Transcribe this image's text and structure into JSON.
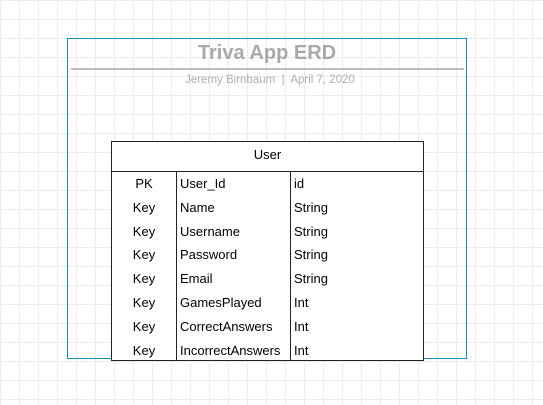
{
  "diagram": {
    "title": "Triva App ERD",
    "subtitle": "Jeremy Birnbaum  |  April 7, 2020"
  },
  "entity": {
    "name": "User",
    "rows": [
      {
        "key": "PK",
        "name": "User_Id",
        "type": "id"
      },
      {
        "key": "Key",
        "name": "Name",
        "type": "String"
      },
      {
        "key": "Key",
        "name": "Username",
        "type": "String"
      },
      {
        "key": "Key",
        "name": "Password",
        "type": "String"
      },
      {
        "key": "Key",
        "name": "Email",
        "type": "String"
      },
      {
        "key": "Key",
        "name": "GamesPlayed",
        "type": "Int"
      },
      {
        "key": "Key",
        "name": "CorrectAnswers",
        "type": "Int"
      },
      {
        "key": "Key",
        "name": "IncorrectAnswers",
        "type": "Int"
      }
    ]
  },
  "colors": {
    "frame_border": "#1b8bbf",
    "title_text": "#a9a9a9",
    "grid_line": "#ececec"
  }
}
